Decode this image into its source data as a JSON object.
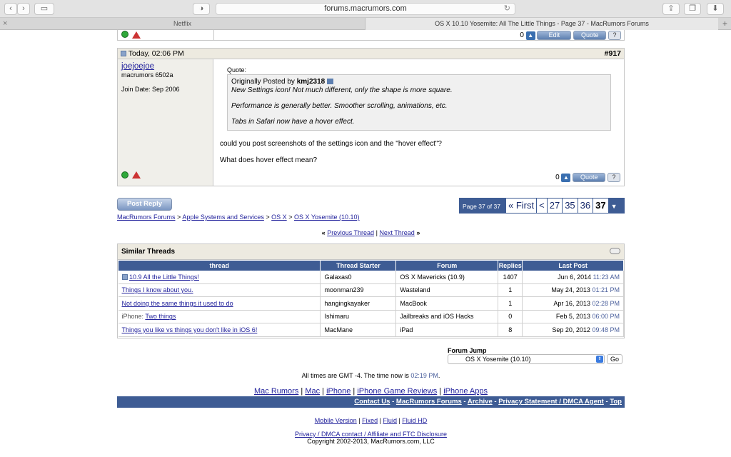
{
  "browser": {
    "url": "forums.macrumors.com",
    "tabs": [
      {
        "label": "Netflix"
      },
      {
        "label": "OS X 10.10 Yosemite: All The Little Things - Page 37 - MacRumors Forums"
      }
    ],
    "new_tab": "+",
    "close_tab": "×"
  },
  "post_prev": {
    "score": "0",
    "edit_label": "Edit",
    "quote_label": "Quote"
  },
  "post": {
    "date": "Today, 02:06 PM",
    "number": "#917",
    "username": "joejoejoe",
    "user_title": "macrumors 6502a",
    "join_date": "Join Date: Sep 2006",
    "quote_label": "Quote:",
    "quote_posted_by": "Originally Posted by",
    "quote_author": "kmj2318",
    "quote_lines": [
      "New Settings icon! Not much different, only the shape is more square.",
      "Performance is generally better. Smoother scrolling, animations, etc.",
      "Tabs in Safari now have a hover effect."
    ],
    "body_lines": [
      "could you post screenshots of the settings icon and the \"hover effect\"?",
      "What does hover effect mean?"
    ],
    "score": "0",
    "quote_button": "Quote"
  },
  "post_reply": "Post Reply",
  "pagination": {
    "summary": "Page 37 of 37",
    "first": "« First",
    "prev": "<",
    "pages": [
      "27",
      "35",
      "36"
    ],
    "current": "37"
  },
  "breadcrumb": [
    "MacRumors Forums",
    "Apple Systems and Services",
    "OS X",
    "OS X Yosemite (10.10)"
  ],
  "breadcrumb_sep": ">",
  "thread_nav": {
    "prev": "Previous Thread",
    "next": "Next Thread",
    "sep": "|",
    "left_mark": "«",
    "right_mark": "»"
  },
  "similar": {
    "title": "Similar Threads",
    "headers": [
      "thread",
      "Thread Starter",
      "Forum",
      "Replies",
      "Last Post"
    ],
    "rows": [
      {
        "prefix": "",
        "thread": "10.9 All the Little Things!",
        "starter": "Galaxas0",
        "forum": "OS X Mavericks (10.9)",
        "replies": "1407",
        "date": "Jun 6, 2014",
        "time": "11:23 AM"
      },
      {
        "prefix": "",
        "thread": "Things I know about you.",
        "starter": "moonman239",
        "forum": "Wasteland",
        "replies": "1",
        "date": "May 24, 2013",
        "time": "01:21 PM"
      },
      {
        "prefix": "",
        "thread": "Not doing the same things it used to do",
        "starter": "hangingkayaker",
        "forum": "MacBook",
        "replies": "1",
        "date": "Apr 16, 2013",
        "time": "02:28 PM"
      },
      {
        "prefix": "iPhone:",
        "thread": "Two things",
        "starter": "Ishimaru",
        "forum": "Jailbreaks and iOS Hacks",
        "replies": "0",
        "date": "Feb 5, 2013",
        "time": "06:00 PM"
      },
      {
        "prefix": "",
        "thread": "Things you like vs things you don't like in iOS 6!",
        "starter": "MacMane",
        "forum": "iPad",
        "replies": "8",
        "date": "Sep 20, 2012",
        "time": "09:48 PM"
      }
    ]
  },
  "forum_jump": {
    "label": "Forum Jump",
    "selected": "OS X Yosemite (10.10)",
    "go": "Go"
  },
  "timezone": {
    "text": "All times are GMT -4. The time now is",
    "time": "02:19 PM",
    "end": "."
  },
  "footer_links": [
    "Mac Rumors",
    "Mac",
    "iPhone",
    "iPhone Game Reviews",
    "iPhone Apps"
  ],
  "footer_bar": [
    "Contact Us",
    "MacRumors Forums",
    "Archive",
    "Privacy Statement / DMCA Agent",
    "Top"
  ],
  "footer_bar_sep": "-",
  "version_links": [
    "Mobile Version",
    "Fixed",
    "Fluid",
    "Fluid HD"
  ],
  "legal_link": "Privacy / DMCA contact / Affiliate and FTC Disclosure",
  "copyright": "Copyright 2002-2013, MacRumors.com, LLC",
  "colors": {
    "accent": "#3e5c94",
    "link": "#22229c",
    "time": "#4a5f9c"
  }
}
